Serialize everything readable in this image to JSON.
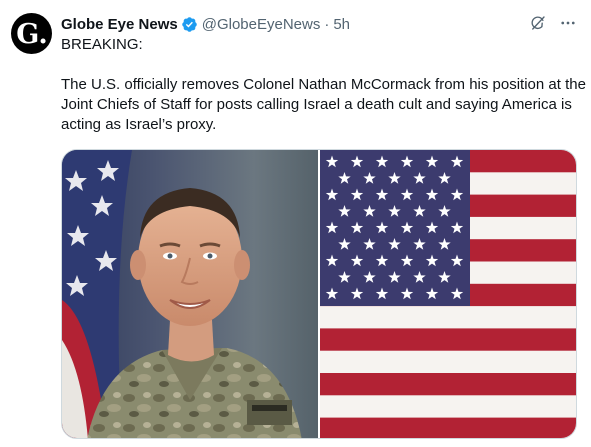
{
  "tweet": {
    "author_name": "Globe Eye News",
    "author_handle": "@GlobeEyeNews",
    "separator": "·",
    "time": "5h",
    "avatar_letter": "G.",
    "verified": true,
    "line1": "BREAKING:",
    "body": "The U.S. officially removes Colonel Nathan McCormack from his position at the Joint Chiefs of Staff for posts calling Israel a death cult and saying America is acting as Israel’s proxy."
  },
  "icons": {
    "verified": "verified-badge-icon",
    "grok": "grok-icon",
    "more": "more-icon"
  },
  "media": {
    "left_image": "portrait-photo",
    "right_image": "us-flag-photo"
  },
  "colors": {
    "verified_blue": "#1d9bf0",
    "flag_red": "#b22234",
    "flag_blue": "#3c3b6e",
    "muted_text": "#536471"
  }
}
